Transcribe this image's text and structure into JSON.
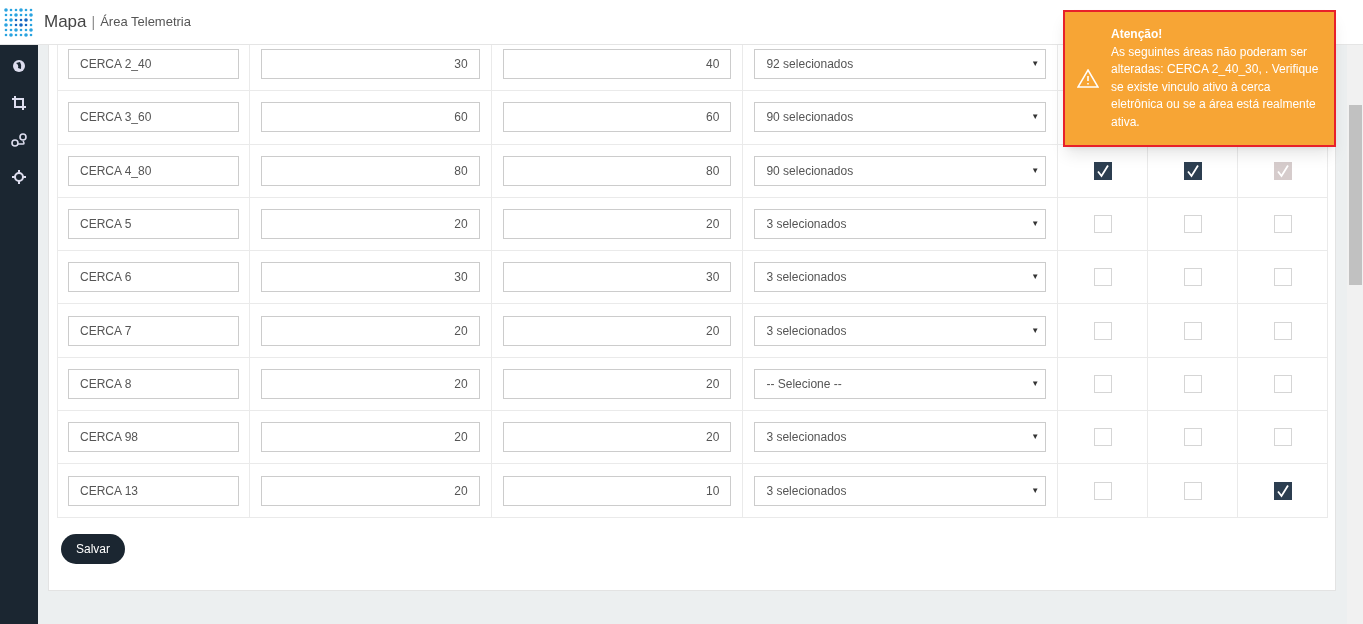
{
  "header": {
    "title": "Mapa",
    "separator": "|",
    "subtitle": "Área Telemetria"
  },
  "select_caret": "▼",
  "rows": [
    {
      "name": "CERCA 2_40",
      "min": "30",
      "max": "40",
      "select": "92 selecionados"
    },
    {
      "name": "CERCA 3_60",
      "min": "60",
      "max": "60",
      "select": "90 selecionados"
    },
    {
      "name": "CERCA 4_80",
      "min": "80",
      "max": "80",
      "select": "90 selecionados",
      "checks": [
        {
          "checked": true,
          "disabled": false
        },
        {
          "checked": true,
          "disabled": false
        },
        {
          "checked": true,
          "disabled": true
        }
      ]
    },
    {
      "name": "CERCA 5",
      "min": "20",
      "max": "20",
      "select": "3 selecionados",
      "checks": [
        {
          "checked": false,
          "disabled": false
        },
        {
          "checked": false,
          "disabled": false
        },
        {
          "checked": false,
          "disabled": false
        }
      ]
    },
    {
      "name": "CERCA 6",
      "min": "30",
      "max": "30",
      "select": "3 selecionados",
      "checks": [
        {
          "checked": false,
          "disabled": false
        },
        {
          "checked": false,
          "disabled": false
        },
        {
          "checked": false,
          "disabled": false
        }
      ]
    },
    {
      "name": "CERCA 7",
      "min": "20",
      "max": "20",
      "select": "3 selecionados",
      "checks": [
        {
          "checked": false,
          "disabled": false
        },
        {
          "checked": false,
          "disabled": false
        },
        {
          "checked": false,
          "disabled": false
        }
      ]
    },
    {
      "name": "CERCA 8",
      "min": "20",
      "max": "20",
      "select": "-- Selecione --",
      "checks": [
        {
          "checked": false,
          "disabled": false
        },
        {
          "checked": false,
          "disabled": false
        },
        {
          "checked": false,
          "disabled": false
        }
      ]
    },
    {
      "name": "CERCA 98",
      "min": "20",
      "max": "20",
      "select": "3 selecionados",
      "checks": [
        {
          "checked": false,
          "disabled": false
        },
        {
          "checked": false,
          "disabled": false
        },
        {
          "checked": false,
          "disabled": false
        }
      ]
    },
    {
      "name": "CERCA 13",
      "min": "20",
      "max": "10",
      "select": "3 selecionados",
      "checks": [
        {
          "checked": false,
          "disabled": false
        },
        {
          "checked": false,
          "disabled": false
        },
        {
          "checked": true,
          "disabled": false
        }
      ]
    }
  ],
  "save_button": "Salvar",
  "toast": {
    "title": "Atenção!",
    "message": "As seguintes áreas não poderam ser alteradas: CERCA 2_40_30, . Verifique se existe vinculo ativo à cerca eletrônica ou se a área está realmente ativa."
  }
}
